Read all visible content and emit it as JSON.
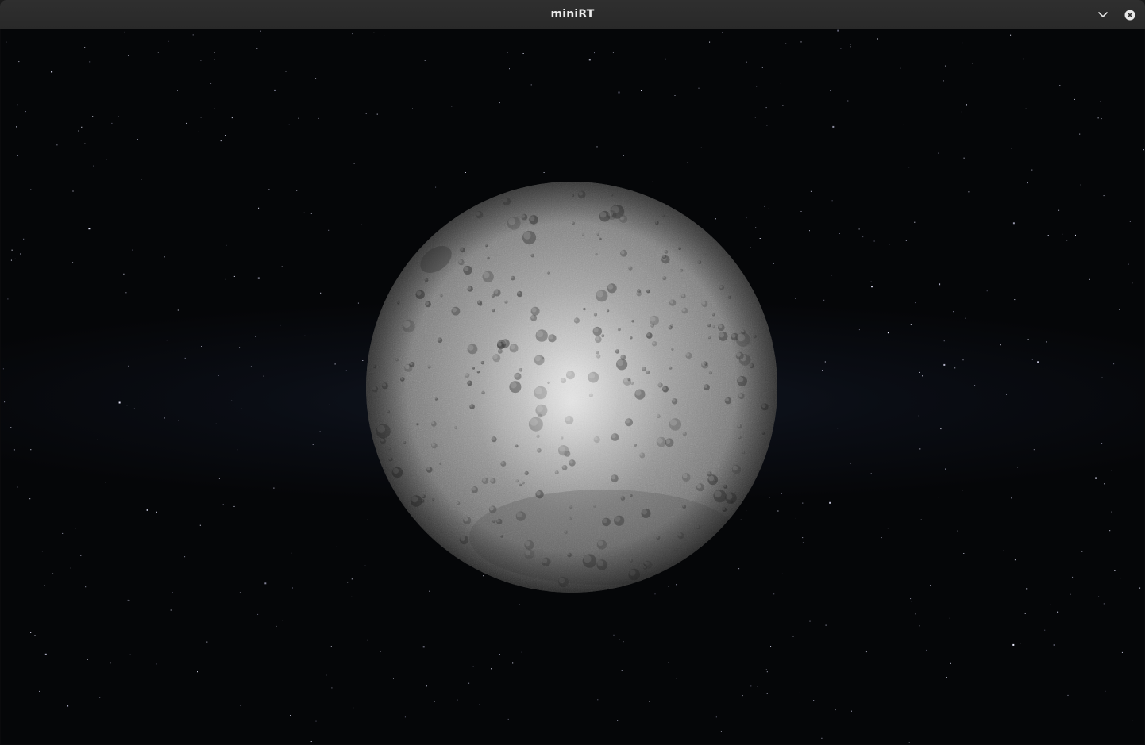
{
  "window": {
    "title": "miniRT"
  },
  "titlebar": {
    "minimize_icon": "chevron-down-icon",
    "close_icon": "close-circle-icon"
  },
  "scene": {
    "background_color": "#050608",
    "sphere_color": "#9a9a9a",
    "highlight_color": "#f2f2f2"
  }
}
